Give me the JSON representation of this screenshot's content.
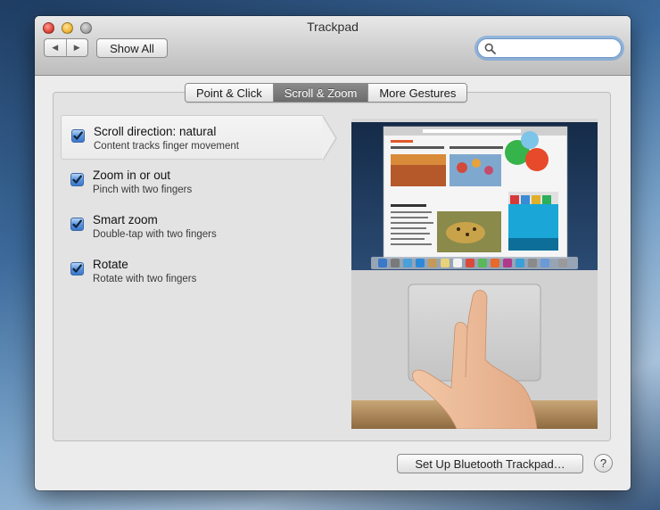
{
  "window": {
    "title": "Trackpad"
  },
  "toolbar": {
    "back_icon": "chevron-left-icon",
    "forward_icon": "chevron-right-icon",
    "show_all_label": "Show All",
    "search": {
      "value": "",
      "placeholder": "",
      "icon": "search-icon"
    }
  },
  "tabs": [
    {
      "label": "Point & Click",
      "active": false
    },
    {
      "label": "Scroll & Zoom",
      "active": true
    },
    {
      "label": "More Gestures",
      "active": false
    }
  ],
  "options": [
    {
      "title": "Scroll direction: natural",
      "subtitle": "Content tracks finger movement",
      "checked": true,
      "selected": true
    },
    {
      "title": "Zoom in or out",
      "subtitle": "Pinch with two fingers",
      "checked": true,
      "selected": false
    },
    {
      "title": "Smart zoom",
      "subtitle": "Double-tap with two fingers",
      "checked": true,
      "selected": false
    },
    {
      "title": "Rotate",
      "subtitle": "Rotate with two fingers",
      "checked": true,
      "selected": false
    }
  ],
  "footer": {
    "setup_label": "Set Up Bluetooth Trackpad…",
    "help_label": "?"
  },
  "colors": {
    "accent": "#3b77cb",
    "active_tab": "#7a7a7a",
    "window_bg": "#ececec"
  }
}
